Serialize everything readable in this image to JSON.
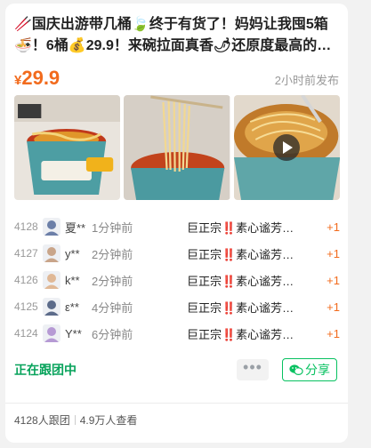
{
  "post": {
    "title": "🥢国庆出游带几桶🍃终于有货了！妈妈让我囤5箱🍜！6桶💰29.9！来碗拉面真香🌶还原度最高的…",
    "price_currency": "¥",
    "price_value": "29.9",
    "posted_time": "2小时前发布"
  },
  "photos": [
    {
      "name": "noodle-cup-photo-1",
      "has_play": false
    },
    {
      "name": "noodle-chopsticks-photo",
      "has_play": false
    },
    {
      "name": "noodle-fork-photo",
      "has_play": true
    }
  ],
  "orders": [
    {
      "no": "4128",
      "buyer": "夏**",
      "ago": "1分钟前",
      "item": "巨正宗‼️素心谧芳…",
      "qty": "+1",
      "avatar_color": "#6c7fa8"
    },
    {
      "no": "4127",
      "buyer": "y**",
      "ago": "2分钟前",
      "item": "巨正宗‼️素心谧芳…",
      "qty": "+1",
      "avatar_color": "#c9a58a"
    },
    {
      "no": "4126",
      "buyer": "k**",
      "ago": "2分钟前",
      "item": "巨正宗‼️素心谧芳…",
      "qty": "+1",
      "avatar_color": "#e0b896"
    },
    {
      "no": "4125",
      "buyer": "ε**",
      "ago": "4分钟前",
      "item": "巨正宗‼️素心谧芳…",
      "qty": "+1",
      "avatar_color": "#5c6b8a"
    },
    {
      "no": "4124",
      "buyer": "Y**",
      "ago": "6分钟前",
      "item": "巨正宗‼️素心谧芳…",
      "qty": "+1",
      "avatar_color": "#b69ad4"
    }
  ],
  "actions": {
    "status_label": "正在跟团中",
    "more_label": "•••",
    "share_label": "分享"
  },
  "stats": {
    "joined": "4128人跟团",
    "views": "4.9万人查看"
  },
  "colors": {
    "accent_orange": "#f26b1d",
    "accent_green": "#07c160",
    "status_green": "#07a35b"
  }
}
